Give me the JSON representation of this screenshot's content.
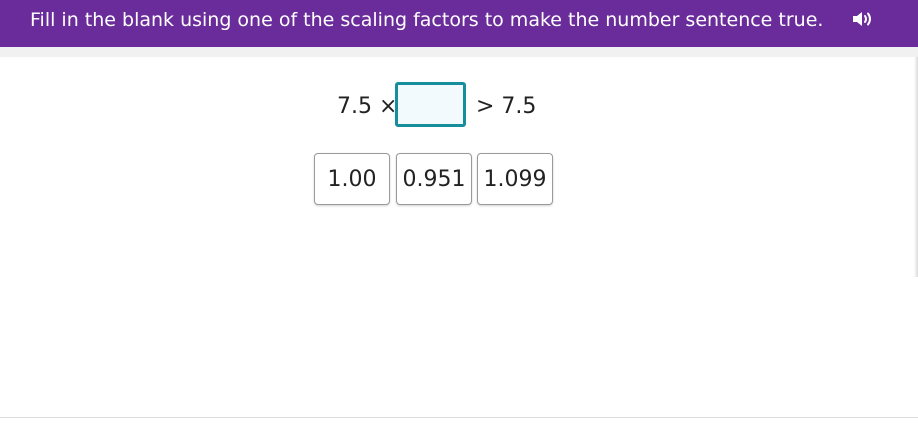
{
  "header": {
    "prompt": "Fill in the blank using one of the scaling factors to make the number sentence true.",
    "speaker_icon": "speaker-icon",
    "background_color": "#6a2c9a"
  },
  "equation": {
    "left": "7.5 ×",
    "blank_value": "",
    "right": "> 7.5"
  },
  "choices": [
    {
      "label": "1.00"
    },
    {
      "label": "0.951"
    },
    {
      "label": "1.099"
    }
  ],
  "accent_color": "#178e9c"
}
